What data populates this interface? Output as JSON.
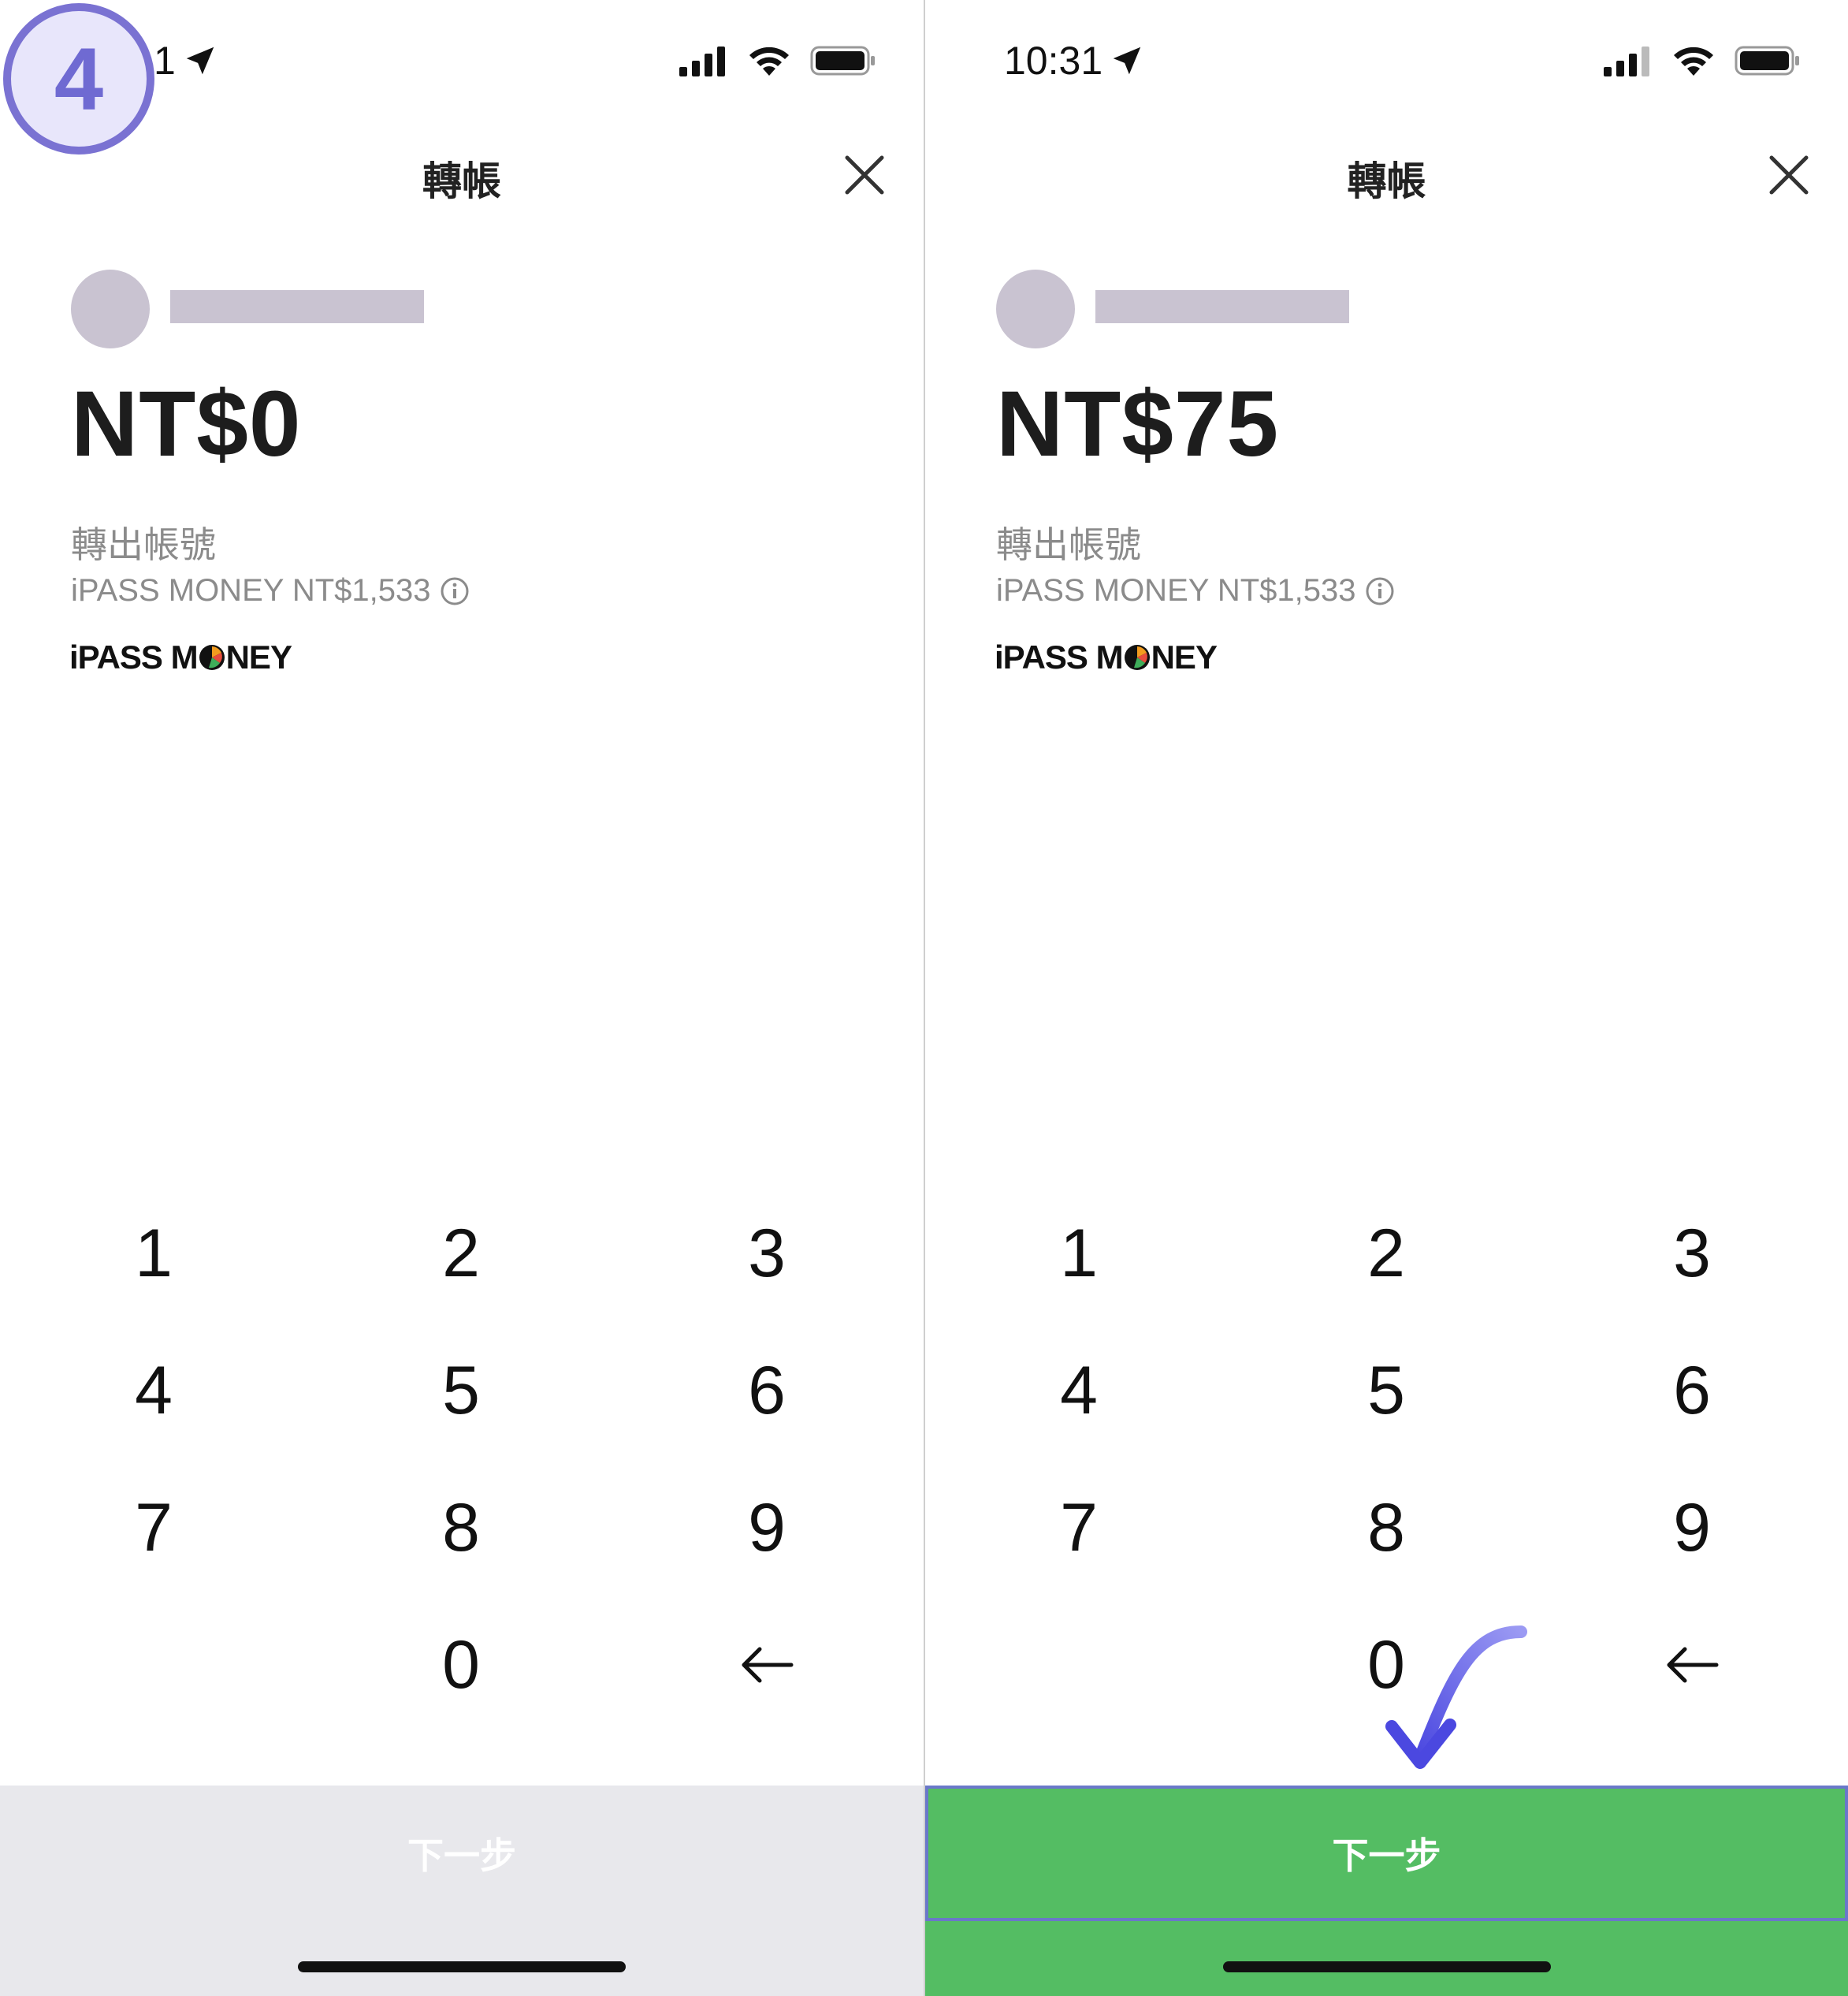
{
  "step_badge": {
    "number": "4"
  },
  "left": {
    "status_time": "1",
    "title": "轉帳",
    "amount": "NT$0",
    "account_label": "轉出帳號",
    "account_value": "iPASS MONEY NT$1,533",
    "brand": {
      "before": "iPASS M",
      "after": "NEY"
    },
    "keys": [
      "1",
      "2",
      "3",
      "4",
      "5",
      "6",
      "7",
      "8",
      "9",
      "0"
    ],
    "next_label": "下一步",
    "next_enabled": false
  },
  "right": {
    "status_time": "10:31",
    "title": "轉帳",
    "amount": "NT$75",
    "account_label": "轉出帳號",
    "account_value": "iPASS MONEY NT$1,533",
    "brand": {
      "before": "iPASS M",
      "after": "NEY"
    },
    "keys": [
      "1",
      "2",
      "3",
      "4",
      "5",
      "6",
      "7",
      "8",
      "9",
      "0"
    ],
    "next_label": "下一步",
    "next_enabled": true
  },
  "colors": {
    "accent_green": "#54bd63",
    "disabled_gray": "#e8e8ec",
    "annotation_purple": "#7a72d2"
  },
  "icons": [
    "location-arrow-icon",
    "cellular-signal-icon",
    "wifi-icon",
    "battery-icon",
    "close-icon",
    "info-icon",
    "backspace-arrow-icon"
  ]
}
